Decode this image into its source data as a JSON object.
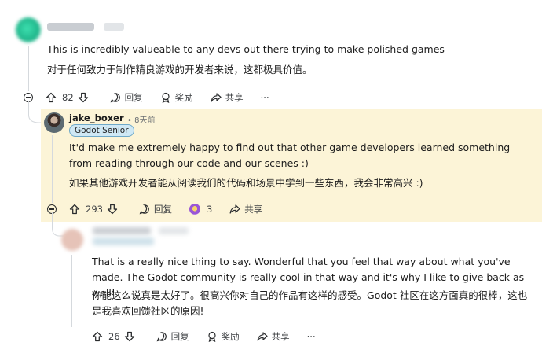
{
  "comment1": {
    "text_en": "This is incredibly valueable to any devs out there trying to make polished games",
    "text_zh": "对于任何致力于制作精良游戏的开发者来说，这都极具价值。",
    "votes": "82",
    "reply_label": "回复",
    "award_label": "奖励",
    "share_label": "共享",
    "more_label": "···"
  },
  "comment2": {
    "username": "jake_boxer",
    "time": "• 8天前",
    "flair": "Godot Senior",
    "text_en": "It'd make me extremely happy to find out that other game developers learned something from reading through our code and our scenes :)",
    "text_zh": "如果其他游戏开发者能从阅读我们的代码和场景中学到一些东西，我会非常高兴 :)",
    "votes": "293",
    "reply_label": "回复",
    "award_count": "3",
    "share_label": "共享"
  },
  "comment3": {
    "text_en": "That is a really nice thing to say. Wonderful that you feel that way about what you've made. The Godot community is really cool in that way and it's why I like to give back as well!",
    "text_zh": "你能这么说真是太好了。很高兴你对自己的作品有这样的感受。Godot 社区在这方面真的很棒，这也是我喜欢回馈社区的原因!",
    "votes": "26",
    "reply_label": "回复",
    "award_label": "奖励",
    "share_label": "共享",
    "more_label": "···"
  },
  "colors": {
    "highlight": "#fcf4d7",
    "flair_bg": "#cfe8f4",
    "thread_line": "#d5d9dd"
  }
}
